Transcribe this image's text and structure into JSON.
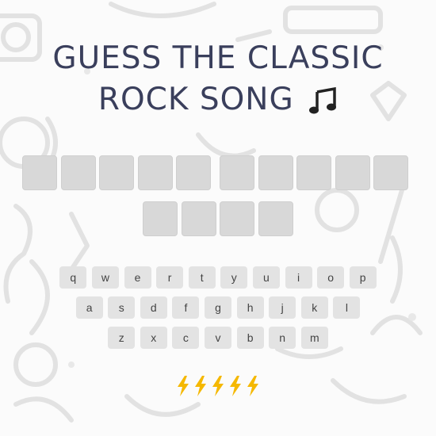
{
  "title": {
    "line1": "GUESS THE CLASSIC",
    "line2": "ROCK SONG"
  },
  "puzzle": {
    "words": [
      5,
      5,
      4
    ],
    "revealed_letters": []
  },
  "keyboard": {
    "row1": [
      "q",
      "w",
      "e",
      "r",
      "t",
      "y",
      "u",
      "i",
      "o",
      "p"
    ],
    "row2": [
      "a",
      "s",
      "d",
      "f",
      "g",
      "h",
      "j",
      "k",
      "l"
    ],
    "row3": [
      "z",
      "x",
      "c",
      "v",
      "b",
      "n",
      "m"
    ]
  },
  "lives": {
    "remaining": 5,
    "icon": "lightning-bolt-icon",
    "color": "#f5b800"
  },
  "colors": {
    "title": "#3a3f5c",
    "tile": "#d8d8d8",
    "key": "#e3e3e3"
  }
}
